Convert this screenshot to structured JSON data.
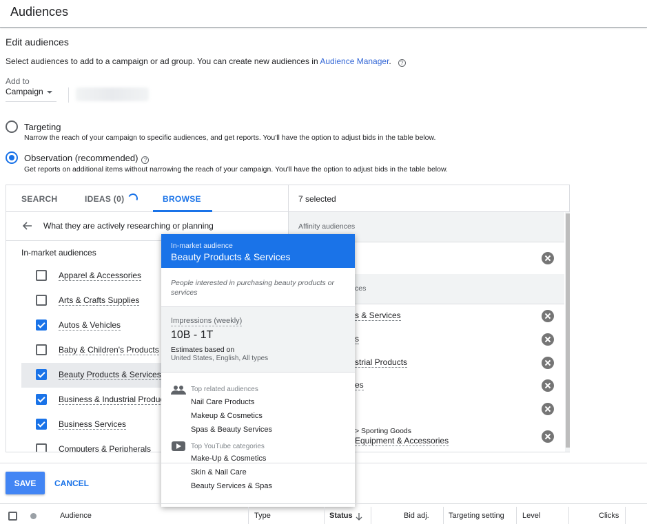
{
  "header": {
    "title": "Audiences"
  },
  "edit": {
    "title": "Edit audiences",
    "intro_text": "Select audiences to add to a campaign or ad group. You can create new audiences in ",
    "intro_link": "Audience Manager",
    "intro_end": ".",
    "help_icon": "?"
  },
  "add_to": {
    "label": "Add to",
    "value": "Campaign"
  },
  "options": [
    {
      "title": "Targeting",
      "description": "Narrow the reach of your campaign to specific audiences, and get reports. You'll have the option to adjust bids in the table below.",
      "selected": false
    },
    {
      "title": "Observation (recommended)",
      "description": "Get reports on additional items without narrowing the reach of your campaign. You'll have the option to adjust bids in the table below.",
      "selected": true
    }
  ],
  "tabs": {
    "search": "SEARCH",
    "ideas": "IDEAS (0)",
    "browse": "BROWSE",
    "active": "browse"
  },
  "breadcrumb": "What they are actively researching or planning",
  "section_label": "In-market audiences",
  "categories": [
    {
      "label": "Apparel & Accessories",
      "checked": false
    },
    {
      "label": "Arts & Crafts Supplies",
      "checked": false
    },
    {
      "label": "Autos & Vehicles",
      "checked": true
    },
    {
      "label": "Baby & Children's Products",
      "checked": false
    },
    {
      "label": "Beauty Products & Services",
      "checked": true,
      "highlighted": true
    },
    {
      "label": "Business & Industrial Products",
      "checked": true
    },
    {
      "label": "Business Services",
      "checked": true
    },
    {
      "label": "Computers & Peripherals",
      "checked": false
    }
  ],
  "selected_panel": {
    "count_label": "7 selected",
    "group1": "Affinity audiences",
    "group2_fragment": "ces",
    "items": [
      {
        "label": "s & Services"
      },
      {
        "label": "s"
      },
      {
        "label": "strial Products"
      },
      {
        "label": "es"
      },
      {
        "label": ""
      },
      {
        "sublabel": "> Sporting Goods",
        "label": "Equipment & Accessories"
      }
    ]
  },
  "popup": {
    "kicker": "In-market audience",
    "title": "Beauty Products & Services",
    "description": "People interested in purchasing beauty products or services",
    "impressions_label": "Impressions (weekly)",
    "impressions_value": "10B - 1T",
    "estimates_label": "Estimates based on",
    "estimates_detail": "United States, English, All types",
    "related_label": "Top related audiences",
    "related": [
      "Nail Care Products",
      "Makeup & Cosmetics",
      "Spas & Beauty Services"
    ],
    "youtube_label": "Top YouTube categories",
    "youtube": [
      "Make-Up & Cosmetics",
      "Skin & Nail Care",
      "Beauty Services & Spas"
    ]
  },
  "actions": {
    "save": "SAVE",
    "cancel": "CANCEL"
  },
  "table_columns": [
    "Audience",
    "Type",
    "Status",
    "Bid adj.",
    "Targeting setting",
    "Level",
    "Clicks"
  ],
  "colors": {
    "accent": "#1a73e8",
    "save_button": "#4285f4"
  }
}
